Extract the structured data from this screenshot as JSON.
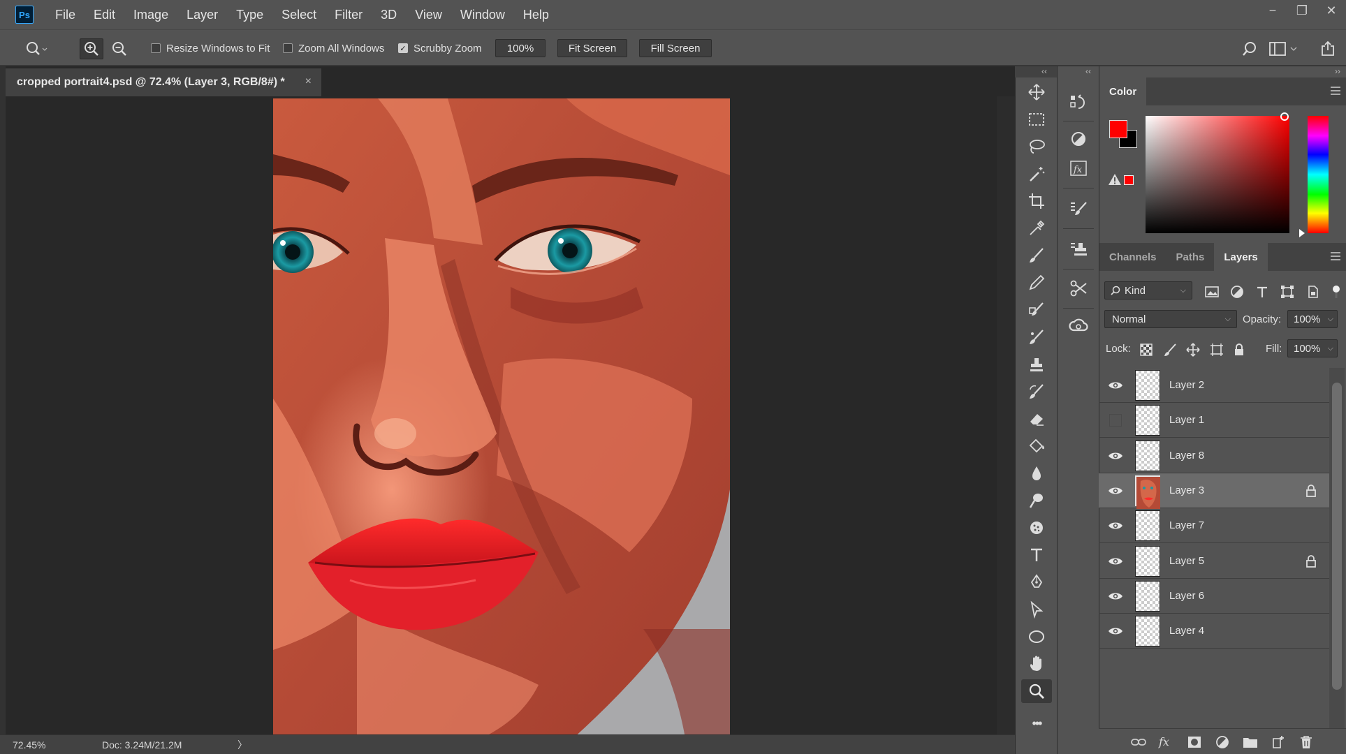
{
  "app": {
    "logo": "Ps"
  },
  "menu": [
    "File",
    "Edit",
    "Image",
    "Layer",
    "Type",
    "Select",
    "Filter",
    "3D",
    "View",
    "Window",
    "Help"
  ],
  "window_controls": {
    "minimize": "−",
    "restore": "❐",
    "close": "✕"
  },
  "options": {
    "resize_windows": "Resize Windows to Fit",
    "zoom_all": "Zoom All Windows",
    "scrubby_zoom": "Scrubby Zoom",
    "zoom_value": "100%",
    "fit_screen": "Fit Screen",
    "fill_screen": "Fill Screen",
    "resize_checked": false,
    "zoom_all_checked": false,
    "scrubby_checked": true
  },
  "document": {
    "tab_title": "cropped portrait4.psd @ 72.4% (Layer 3, RGB/8#) *",
    "close_glyph": "×"
  },
  "status": {
    "zoom": "72.45%",
    "doc": "Doc: 3.24M/21.2M",
    "arrow": "〉"
  },
  "color_panel": {
    "title": "Color",
    "foreground": "#ff0000",
    "background": "#000000"
  },
  "layers_panel": {
    "tabs": [
      "Channels",
      "Paths",
      "Layers"
    ],
    "active_tab": "Layers",
    "kind_filter": "Kind",
    "blend_mode": "Normal",
    "opacity_label": "Opacity:",
    "opacity": "100%",
    "lock_label": "Lock:",
    "fill_label": "Fill:",
    "fill": "100%",
    "layers": [
      {
        "name": "Layer 2",
        "visible": true,
        "locked": false,
        "selected": false
      },
      {
        "name": "Layer 1",
        "visible": false,
        "locked": false,
        "selected": false
      },
      {
        "name": "Layer 8",
        "visible": true,
        "locked": false,
        "selected": false
      },
      {
        "name": "Layer 3",
        "visible": true,
        "locked": true,
        "selected": true
      },
      {
        "name": "Layer 7",
        "visible": true,
        "locked": false,
        "selected": false
      },
      {
        "name": "Layer 5",
        "visible": true,
        "locked": true,
        "selected": false
      },
      {
        "name": "Layer 6",
        "visible": true,
        "locked": false,
        "selected": false
      },
      {
        "name": "Layer 4",
        "visible": true,
        "locked": false,
        "selected": false
      }
    ]
  },
  "tools": [
    "move-tool",
    "marquee-tool",
    "lasso-tool",
    "magic-wand-tool",
    "crop-tool",
    "eyedropper-tool",
    "healing-brush-tool",
    "brush-tool",
    "clone-stamp-tool",
    "history-brush-tool",
    "eraser-tool",
    "paint-bucket-tool",
    "blur-tool",
    "dodge-tool",
    "sponge-tool",
    "type-tool",
    "pen-tool",
    "path-selection-tool",
    "ellipse-tool",
    "hand-tool",
    "zoom-tool",
    "more-tools"
  ],
  "more_glyph": "•••"
}
